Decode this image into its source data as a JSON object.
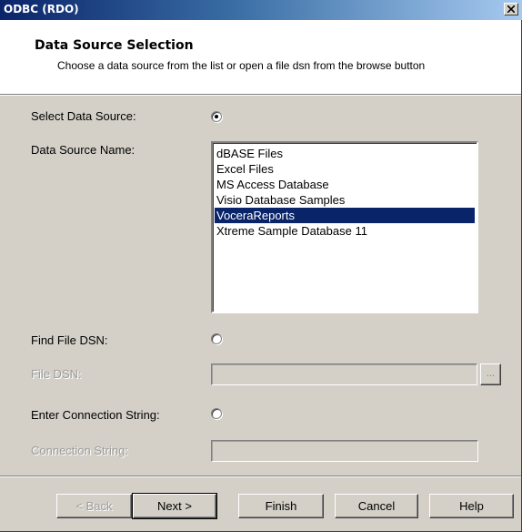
{
  "window": {
    "title": "ODBC (RDO)",
    "close_glyph": "close-icon"
  },
  "header": {
    "title": "Data Source Selection",
    "description": "Choose a data source from the list or open a file dsn from the browse button"
  },
  "form": {
    "select_data_source_label": "Select Data Source:",
    "select_data_source_selected": true,
    "data_source_name_label": "Data Source Name:",
    "data_sources": [
      "dBASE Files",
      "Excel Files",
      "MS Access Database",
      "Visio Database Samples",
      "VoceraReports",
      "Xtreme Sample Database 11"
    ],
    "selected_data_source": "VoceraReports",
    "find_file_dsn_label": "Find File DSN:",
    "find_file_dsn_selected": false,
    "file_dsn_label": "File DSN:",
    "file_dsn_value": "",
    "browse_label": "...",
    "enter_connection_string_label": "Enter Connection String:",
    "enter_connection_string_selected": false,
    "connection_string_label": "Connection String:",
    "connection_string_value": ""
  },
  "buttons": {
    "back": "< Back",
    "next": "Next >",
    "finish": "Finish",
    "cancel": "Cancel",
    "help": "Help"
  },
  "colors": {
    "titlebar_start": "#0a246a",
    "titlebar_end": "#a6caf0",
    "selection": "#0a246a",
    "dialog_face": "#d4d0c8"
  }
}
